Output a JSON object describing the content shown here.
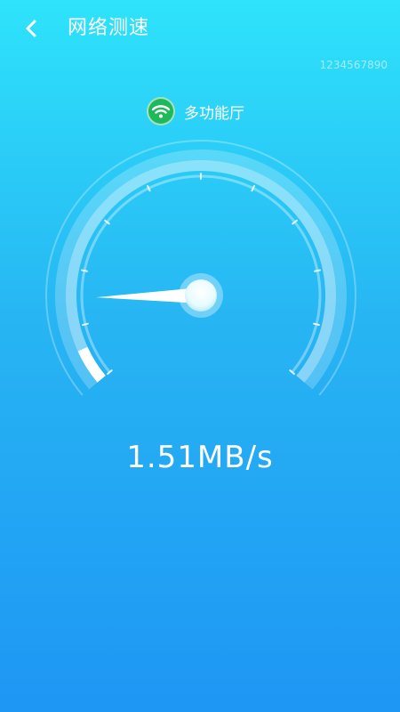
{
  "header": {
    "back_icon": "chevron-left-icon",
    "title": "网络测速"
  },
  "device": {
    "id": "1234567890"
  },
  "network": {
    "icon": "wifi-icon",
    "name": "多功能厅",
    "badge_color": "#1fb85a"
  },
  "gauge": {
    "fraction": 0.06,
    "tick_count": 11,
    "accent_color": "#ffffff"
  },
  "speed": {
    "value": "1.51MB/s"
  }
}
